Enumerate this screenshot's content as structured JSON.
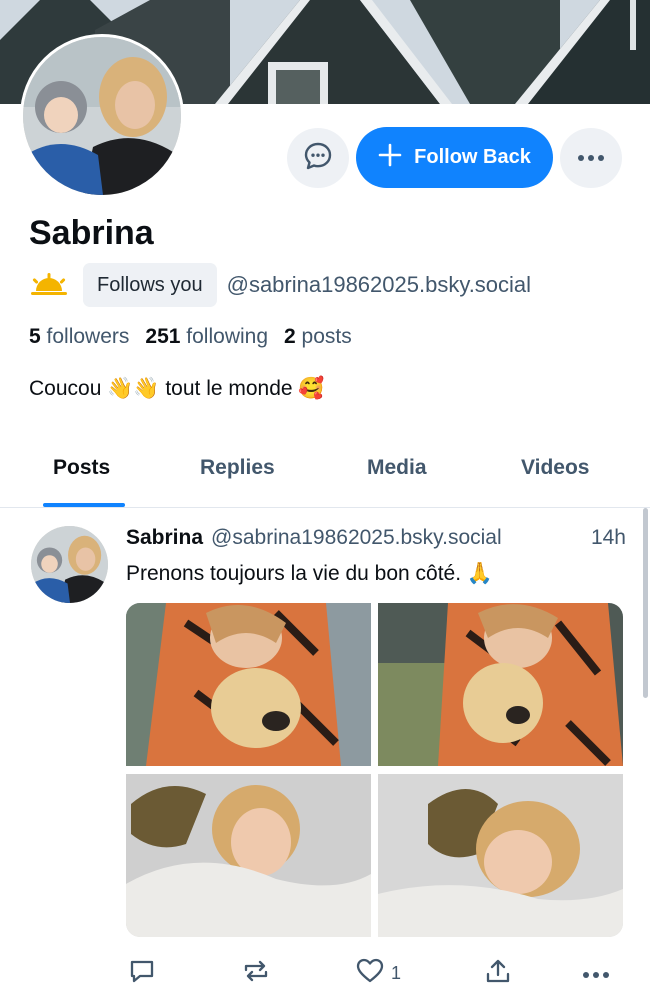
{
  "profile": {
    "display_name": "Sabrina",
    "follows_you_label": "Follows you",
    "handle": "@sabrina19862025.bsky.social",
    "bio": "Coucou 👋👋 tout le monde 🥰",
    "stats": {
      "followers_count": "5",
      "followers_label": "followers",
      "following_count": "251",
      "following_label": "following",
      "posts_count": "2",
      "posts_label": "posts"
    }
  },
  "actions": {
    "follow_back_label": "Follow Back",
    "message_icon": "chat-bubble-icon",
    "more_icon": "ellipsis-icon"
  },
  "tabs": [
    {
      "label": "Posts",
      "active": true
    },
    {
      "label": "Replies",
      "active": false
    },
    {
      "label": "Media",
      "active": false
    },
    {
      "label": "Videos",
      "active": false
    }
  ],
  "post": {
    "author": "Sabrina",
    "handle": "@sabrina19862025.bsky.social",
    "time": "14h",
    "text": "Prenons toujours la vie du bon côté. 🙏",
    "like_count": "1"
  },
  "colors": {
    "accent": "#1083fe",
    "muted_text": "#42576c",
    "button_bg": "#eef1f5"
  }
}
